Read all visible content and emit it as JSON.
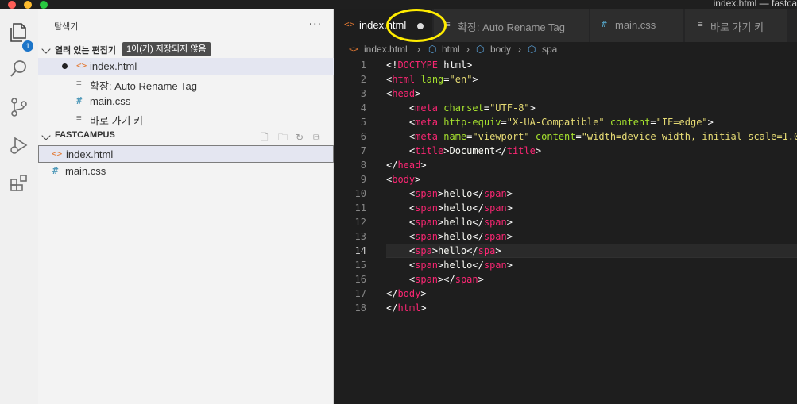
{
  "window": {
    "title": "index.html — fastca"
  },
  "sidebar": {
    "header": "탐색기",
    "more": "···",
    "badge_count": "1",
    "open_editors": {
      "label": "열려 있는 편집기",
      "unsaved_badge": "1이(가) 저장되지 않음",
      "items": [
        {
          "name": "index.html",
          "icon": "html-file-icon",
          "dirty": true
        },
        {
          "name": "확장: Auto Rename Tag",
          "icon": "extension-doc-icon"
        },
        {
          "name": "main.css",
          "icon": "css-file-icon"
        },
        {
          "name": "바로 가기 키",
          "icon": "keybindings-doc-icon"
        }
      ]
    },
    "workspace": {
      "label": "FASTCAMPUS",
      "files": [
        {
          "name": "index.html",
          "icon": "html-file-icon"
        },
        {
          "name": "main.css",
          "icon": "css-file-icon"
        }
      ]
    }
  },
  "tabs": [
    {
      "label": "index.html",
      "icon": "html-file-icon",
      "active": true,
      "dirty": true
    },
    {
      "label": "확장: Auto Rename Tag",
      "icon": "extension-doc-icon"
    },
    {
      "label": "main.css",
      "icon": "css-file-icon"
    },
    {
      "label": "바로 가기 키",
      "icon": "keybindings-doc-icon"
    }
  ],
  "breadcrumb": [
    "index.html",
    "html",
    "body",
    "spa"
  ],
  "editor": {
    "active_line": 14,
    "lines": [
      {
        "n": "1",
        "t": [
          [
            "pn",
            "<!"
          ],
          [
            "tg",
            "DOCTYPE"
          ],
          [
            "pn",
            " html>"
          ]
        ]
      },
      {
        "n": "2",
        "t": [
          [
            "pn",
            "<"
          ],
          [
            "tg",
            "html"
          ],
          [
            "pn",
            " "
          ],
          [
            "at",
            "lang"
          ],
          [
            "pn",
            "="
          ],
          [
            "st",
            "\"en\""
          ],
          [
            "pn",
            ">"
          ]
        ]
      },
      {
        "n": "3",
        "t": [
          [
            "pn",
            "<"
          ],
          [
            "tg",
            "head"
          ],
          [
            "pn",
            ">"
          ]
        ]
      },
      {
        "n": "4",
        "t": [
          [
            "pn",
            "    <"
          ],
          [
            "tg",
            "meta"
          ],
          [
            "pn",
            " "
          ],
          [
            "at",
            "charset"
          ],
          [
            "pn",
            "="
          ],
          [
            "st",
            "\"UTF-8\""
          ],
          [
            "pn",
            ">"
          ]
        ]
      },
      {
        "n": "5",
        "t": [
          [
            "pn",
            "    <"
          ],
          [
            "tg",
            "meta"
          ],
          [
            "pn",
            " "
          ],
          [
            "at",
            "http-equiv"
          ],
          [
            "pn",
            "="
          ],
          [
            "st",
            "\"X-UA-Compatible\""
          ],
          [
            "pn",
            " "
          ],
          [
            "at",
            "content"
          ],
          [
            "pn",
            "="
          ],
          [
            "st",
            "\"IE=edge\""
          ],
          [
            "pn",
            ">"
          ]
        ]
      },
      {
        "n": "6",
        "t": [
          [
            "pn",
            "    <"
          ],
          [
            "tg",
            "meta"
          ],
          [
            "pn",
            " "
          ],
          [
            "at",
            "name"
          ],
          [
            "pn",
            "="
          ],
          [
            "st",
            "\"viewport\""
          ],
          [
            "pn",
            " "
          ],
          [
            "at",
            "content"
          ],
          [
            "pn",
            "="
          ],
          [
            "st",
            "\"width=device-width, initial-scale=1.0"
          ]
        ]
      },
      {
        "n": "7",
        "t": [
          [
            "pn",
            "    <"
          ],
          [
            "tg",
            "title"
          ],
          [
            "pn",
            ">"
          ],
          [
            "tx",
            "Document"
          ],
          [
            "pn",
            "</"
          ],
          [
            "tg",
            "title"
          ],
          [
            "pn",
            ">"
          ]
        ]
      },
      {
        "n": "8",
        "t": [
          [
            "pn",
            "</"
          ],
          [
            "tg",
            "head"
          ],
          [
            "pn",
            ">"
          ]
        ]
      },
      {
        "n": "9",
        "t": [
          [
            "pn",
            "<"
          ],
          [
            "tg",
            "body"
          ],
          [
            "pn",
            ">"
          ]
        ]
      },
      {
        "n": "10",
        "t": [
          [
            "pn",
            "    <"
          ],
          [
            "tg",
            "span"
          ],
          [
            "pn",
            ">"
          ],
          [
            "tx",
            "hello"
          ],
          [
            "pn",
            "</"
          ],
          [
            "tg",
            "span"
          ],
          [
            "pn",
            ">"
          ]
        ]
      },
      {
        "n": "11",
        "t": [
          [
            "pn",
            "    <"
          ],
          [
            "tg",
            "span"
          ],
          [
            "pn",
            ">"
          ],
          [
            "tx",
            "hello"
          ],
          [
            "pn",
            "</"
          ],
          [
            "tg",
            "span"
          ],
          [
            "pn",
            ">"
          ]
        ]
      },
      {
        "n": "12",
        "t": [
          [
            "pn",
            "    <"
          ],
          [
            "tg",
            "span"
          ],
          [
            "pn",
            ">"
          ],
          [
            "tx",
            "hello"
          ],
          [
            "pn",
            "</"
          ],
          [
            "tg",
            "span"
          ],
          [
            "pn",
            ">"
          ]
        ]
      },
      {
        "n": "13",
        "t": [
          [
            "pn",
            "    <"
          ],
          [
            "tg",
            "span"
          ],
          [
            "pn",
            ">"
          ],
          [
            "tx",
            "hello"
          ],
          [
            "pn",
            "</"
          ],
          [
            "tg",
            "span"
          ],
          [
            "pn",
            ">"
          ]
        ]
      },
      {
        "n": "14",
        "t": [
          [
            "pn",
            "    <"
          ],
          [
            "tg",
            "spa"
          ],
          [
            "pn",
            ">"
          ],
          [
            "tx",
            "hello"
          ],
          [
            "pn",
            "</"
          ],
          [
            "tg",
            "spa"
          ],
          [
            "pn",
            ">"
          ]
        ]
      },
      {
        "n": "15",
        "t": [
          [
            "pn",
            "    <"
          ],
          [
            "tg",
            "span"
          ],
          [
            "pn",
            ">"
          ],
          [
            "tx",
            "hello"
          ],
          [
            "pn",
            "</"
          ],
          [
            "tg",
            "span"
          ],
          [
            "pn",
            ">"
          ]
        ]
      },
      {
        "n": "16",
        "t": [
          [
            "pn",
            "    <"
          ],
          [
            "tg",
            "span"
          ],
          [
            "pn",
            "></"
          ],
          [
            "tg",
            "span"
          ],
          [
            "pn",
            ">"
          ]
        ]
      },
      {
        "n": "17",
        "t": [
          [
            "pn",
            "</"
          ],
          [
            "tg",
            "body"
          ],
          [
            "pn",
            ">"
          ]
        ]
      },
      {
        "n": "18",
        "t": [
          [
            "pn",
            "</"
          ],
          [
            "tg",
            "html"
          ],
          [
            "pn",
            ">"
          ]
        ]
      }
    ]
  },
  "colors": {
    "tag": "#f92672",
    "attr": "#a6e22e",
    "string": "#e6db74",
    "highlight_ring": "#ffec00",
    "badge": "#1b75c9"
  }
}
